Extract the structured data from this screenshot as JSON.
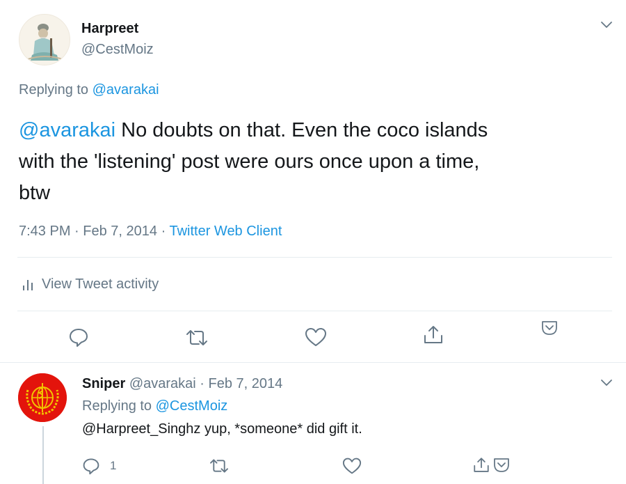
{
  "main_tweet": {
    "display_name": "Harpreet",
    "handle": "@CestMoiz",
    "replying_prefix": "Replying to",
    "replying_to": "@avarakai",
    "mention": "@avarakai",
    "text_line1": "No doubts on that. Even the coco islands",
    "text_line2": "with the 'listening' post were ours once upon a time,",
    "text_line3": "btw",
    "time": "7:43 PM",
    "sep1": "·",
    "date": "Feb 7, 2014",
    "sep2": "·",
    "client": "Twitter Web Client",
    "activity_label": "View Tweet activity"
  },
  "reply_tweet": {
    "display_name": "Sniper",
    "handle": "@avarakai",
    "sep": "·",
    "date": "Feb 7, 2014",
    "replying_prefix": "Replying to",
    "replying_to": "@CestMoiz",
    "text": "@Harpreet_Singhz yup, *someone* did gift it.",
    "reply_count": "1"
  },
  "icons": {
    "caret": "chevron-down-icon",
    "reply": "speech-bubble-icon",
    "retweet": "retweet-arrows-icon",
    "like": "heart-icon",
    "share": "share-upload-icon",
    "analytics": "bar-chart-icon",
    "save": "bookmark-pocket-icon"
  },
  "colors": {
    "link": "#1b95e0",
    "muted": "#657786",
    "text": "#14171a",
    "divider": "#e6ecf0",
    "avatar_reply_bg": "#e3140c",
    "emblem": "#f2c400"
  }
}
